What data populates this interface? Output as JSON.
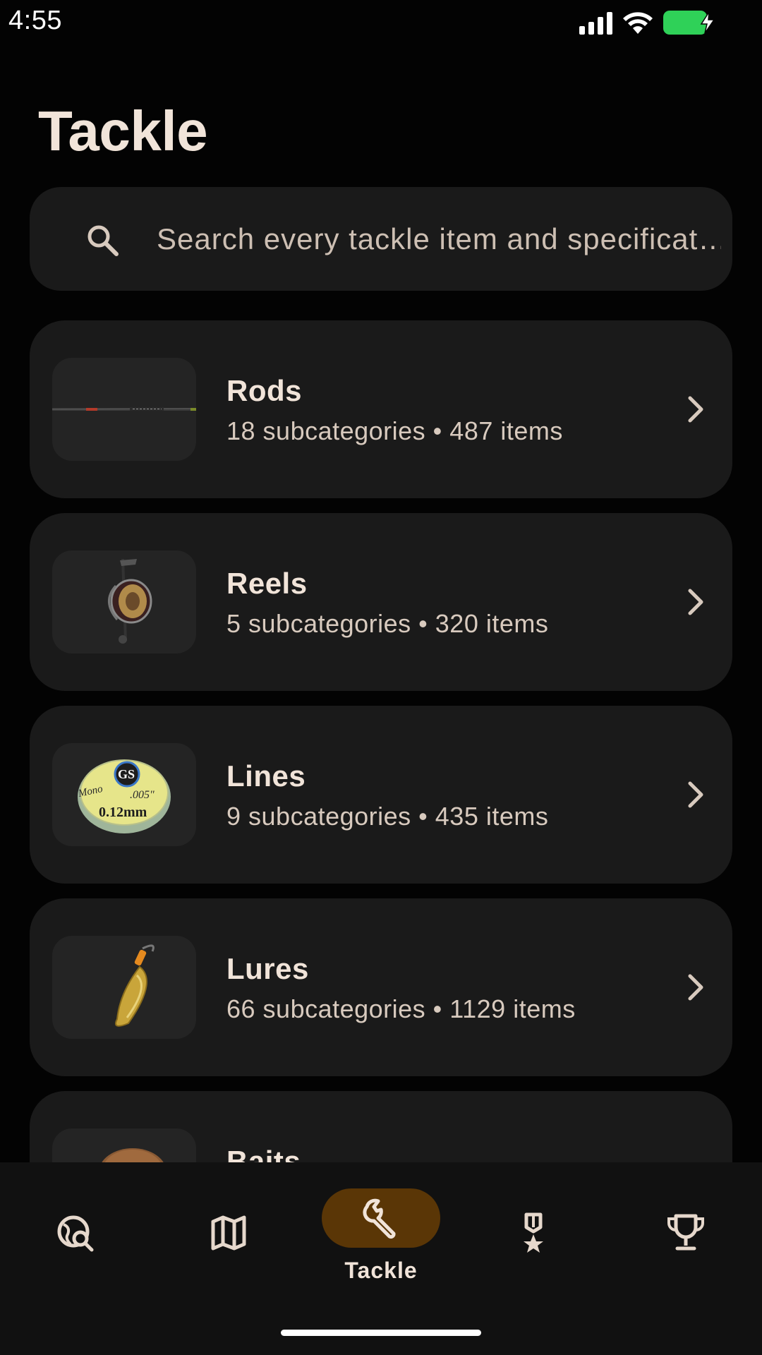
{
  "status_bar": {
    "time": "4:55",
    "icons": [
      "signal-icon",
      "wifi-icon",
      "battery-charging-icon"
    ],
    "battery_color": "#2fd158"
  },
  "page": {
    "title": "Tackle"
  },
  "search": {
    "placeholder": "Search every tackle item and specificat…",
    "icon": "search-icon"
  },
  "categories": [
    {
      "name": "Rods",
      "meta": "18 subcategories • 487 items",
      "image": "fishing-rod"
    },
    {
      "name": "Reels",
      "meta": "5 subcategories • 320 items",
      "image": "spinning-reel"
    },
    {
      "name": "Lines",
      "meta": "9 subcategories • 435 items",
      "image": "line-spool",
      "image_text": [
        "Mono",
        ".005\"",
        "0.12mm"
      ]
    },
    {
      "name": "Lures",
      "meta": "66 subcategories • 1129 items",
      "image": "spoon-lure"
    },
    {
      "name": "Baits",
      "meta": "",
      "image": "bait"
    }
  ],
  "bottom_nav": {
    "items": [
      {
        "icon": "explore-map-search-icon",
        "label": ""
      },
      {
        "icon": "map-icon",
        "label": ""
      },
      {
        "icon": "wrench-icon",
        "label": "Tackle",
        "active": true
      },
      {
        "icon": "medal-icon",
        "label": ""
      },
      {
        "icon": "trophy-icon",
        "label": ""
      }
    ],
    "active_color": "#5a3606"
  },
  "colors": {
    "background": "#030303",
    "card": "#1a1a1a",
    "text_primary": "#f1e4d9",
    "text_secondary": "#d8cabe"
  }
}
